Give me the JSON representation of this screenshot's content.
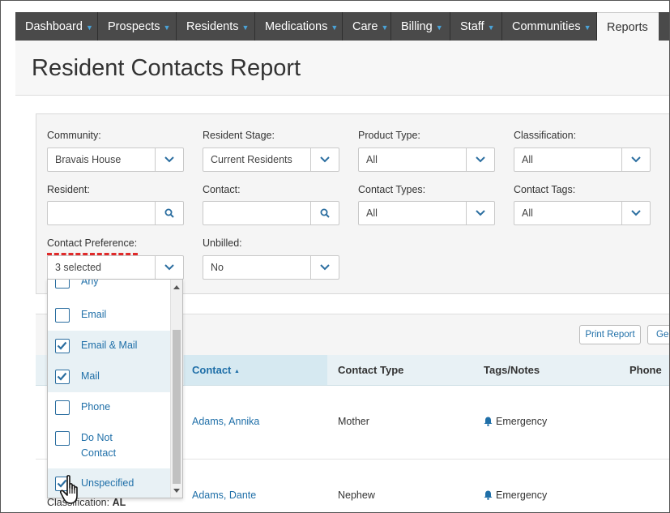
{
  "nav": {
    "items": [
      {
        "label": "Dashboard",
        "caret": true
      },
      {
        "label": "Prospects",
        "caret": true
      },
      {
        "label": "Residents",
        "caret": true
      },
      {
        "label": "Medications",
        "caret": true
      },
      {
        "label": "Care",
        "caret": true
      },
      {
        "label": "Billing",
        "caret": true
      },
      {
        "label": "Staff",
        "caret": true
      },
      {
        "label": "Communities",
        "caret": true
      },
      {
        "label": "Reports",
        "caret": false,
        "active": true
      }
    ]
  },
  "page": {
    "title": "Resident Contacts Report"
  },
  "filters": {
    "community": {
      "label": "Community:",
      "value": "Bravais House"
    },
    "resident_stage": {
      "label": "Resident Stage:",
      "value": "Current Residents"
    },
    "product_type": {
      "label": "Product Type:",
      "value": "All"
    },
    "classification": {
      "label": "Classification:",
      "value": "All"
    },
    "resident": {
      "label": "Resident:",
      "value": ""
    },
    "contact": {
      "label": "Contact:",
      "value": ""
    },
    "contact_types": {
      "label": "Contact Types:",
      "value": "All"
    },
    "contact_tags": {
      "label": "Contact Tags:",
      "value": "All"
    },
    "contact_preference": {
      "label": "Contact Preference:",
      "value": "3 selected"
    },
    "unbilled": {
      "label": "Unbilled:",
      "value": "No"
    }
  },
  "dropdown": {
    "options": [
      {
        "label": "Any",
        "checked": false
      },
      {
        "label": "Email",
        "checked": false
      },
      {
        "label": "Email & Mail",
        "checked": true
      },
      {
        "label": "Mail",
        "checked": true
      },
      {
        "label": "Phone",
        "checked": false
      },
      {
        "label": "Do Not",
        "label2": "Contact",
        "checked": false
      },
      {
        "label": "Unspecified",
        "checked": true
      }
    ]
  },
  "toolbar": {
    "print_label": "Print Report",
    "generate_label": "Gen"
  },
  "table": {
    "headers": {
      "contact": "Contact",
      "sort_arrow": "▲",
      "contact_type": "Contact Type",
      "tags_notes": "Tags/Notes",
      "phone": "Phone"
    },
    "rows": [
      {
        "contact": "Adams, Annika",
        "contact_type": "Mother",
        "tag": "Emergency"
      },
      {
        "contact": "Adams, Dante",
        "contact_type": "Nephew",
        "tag": "Emergency"
      }
    ]
  },
  "peek": {
    "label": "Classification:",
    "value": "AL"
  },
  "colors": {
    "accent": "#1f6fa8",
    "nav_bg": "#4a4a4a",
    "annotation": "#e02a2a"
  }
}
